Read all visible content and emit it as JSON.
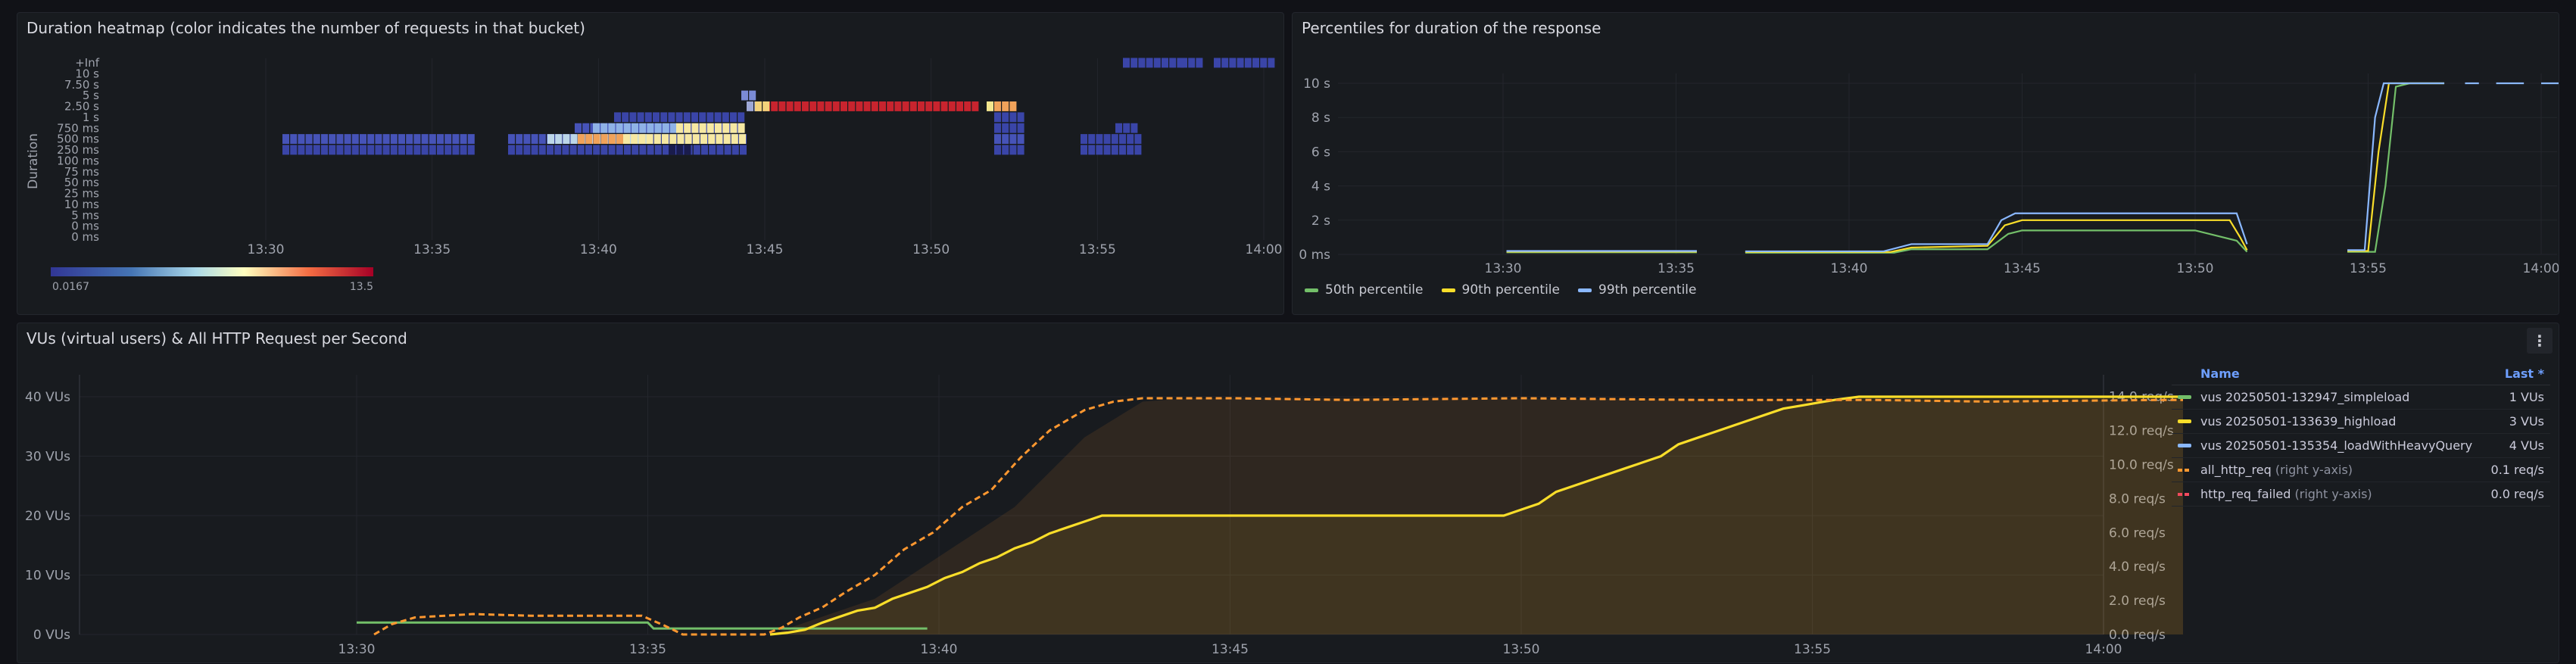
{
  "heatmap": {
    "title": "Duration heatmap (color indicates the number of requests in that bucket)",
    "ylabel": "Duration",
    "y_ticks": [
      "+Inf",
      "10 s",
      "7.50 s",
      "5 s",
      "2.50 s",
      "1 s",
      "750 ms",
      "500 ms",
      "250 ms",
      "100 ms",
      "75 ms",
      "50 ms",
      "25 ms",
      "10 ms",
      "5 ms",
      "0 ms",
      "0 ms"
    ],
    "x_ticks": [
      "13:30",
      "13:35",
      "13:40",
      "13:45",
      "13:50",
      "13:55",
      "14:00"
    ],
    "scale_min": "0.0167",
    "scale_max": "13.5"
  },
  "percentiles": {
    "title": "Percentiles for duration of the response",
    "y_ticks": [
      "0 ms",
      "2 s",
      "4 s",
      "6 s",
      "8 s",
      "10 s"
    ],
    "x_ticks": [
      "13:30",
      "13:35",
      "13:40",
      "13:45",
      "13:50",
      "13:55",
      "14:00"
    ],
    "legend": [
      "50th percentile",
      "90th percentile",
      "99th percentile"
    ],
    "colors": [
      "#73bf69",
      "#fade2a",
      "#8ab8ff"
    ]
  },
  "vus": {
    "title": "VUs (virtual users) & All HTTP Request per Second",
    "left_ticks": [
      "0 VUs",
      "10 VUs",
      "20 VUs",
      "30 VUs",
      "40 VUs"
    ],
    "right_ticks": [
      "0.0 req/s",
      "2.0 req/s",
      "4.0 req/s",
      "6.0 req/s",
      "8.0 req/s",
      "10.0 req/s",
      "12.0 req/s",
      "14.0 req/s"
    ],
    "x_ticks": [
      "13:30",
      "13:35",
      "13:40",
      "13:45",
      "13:50",
      "13:55",
      "14:00"
    ],
    "menu_icon": "⋮",
    "table": {
      "col_name": "Name",
      "col_last": "Last *",
      "rows": [
        {
          "name": "vus 20250501-132947_simpleload",
          "suffix": "",
          "last": "1 VUs",
          "color": "#73bf69",
          "dashed": false
        },
        {
          "name": "vus 20250501-133639_highload",
          "suffix": "",
          "last": "3 VUs",
          "color": "#fade2a",
          "dashed": false
        },
        {
          "name": "vus 20250501-135354_loadWithHeavyQuery",
          "suffix": "",
          "last": "4 VUs",
          "color": "#8ab8ff",
          "dashed": false
        },
        {
          "name": "all_http_req",
          "suffix": " (right y-axis)",
          "last": "0.1 req/s",
          "color": "#ff9830",
          "dashed": true
        },
        {
          "name": "http_req_failed",
          "suffix": " (right y-axis)",
          "last": "0.0 req/s",
          "color": "#f2495c",
          "dashed": true
        }
      ]
    }
  }
}
